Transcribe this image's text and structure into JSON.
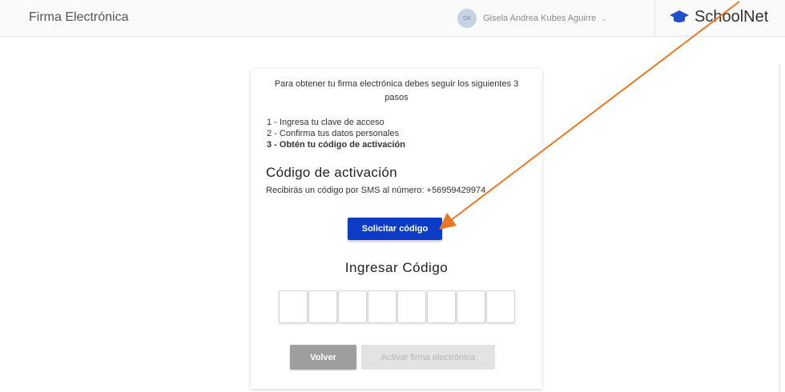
{
  "header": {
    "app_title": "Firma Electrónica",
    "user_initials": "GK",
    "user_name": "Gisela Andrea Kubes Aguirre",
    "brand": "SchoolNet",
    "chevron": "⌄"
  },
  "card": {
    "intro": "Para obtener tu firma electrónica debes seguir los siguientes 3 pasos",
    "steps": [
      "1 - Ingresa tu clave de acceso",
      "2 - Confirma tus datos personales",
      "3 - Obtén tu código de activación"
    ],
    "section_title": "Código de activación",
    "sms_text": "Recibirás un código por SMS al número: +56959429974",
    "request_button": "Solicitar código",
    "enter_code_title": "Ingresar Código",
    "code_values": [
      "",
      "",
      "",
      "",
      "",
      "",
      "",
      ""
    ],
    "back_button": "Volver",
    "activate_button": "Activar firma electrónica"
  },
  "colors": {
    "primary_button": "#0c3cc6",
    "arrow_annotation": "#e87722",
    "brand_icon": "#1f4fc9"
  },
  "icons": {
    "brand": "graduation-cap-icon",
    "user": "avatar",
    "dropdown": "chevron-down-icon"
  }
}
